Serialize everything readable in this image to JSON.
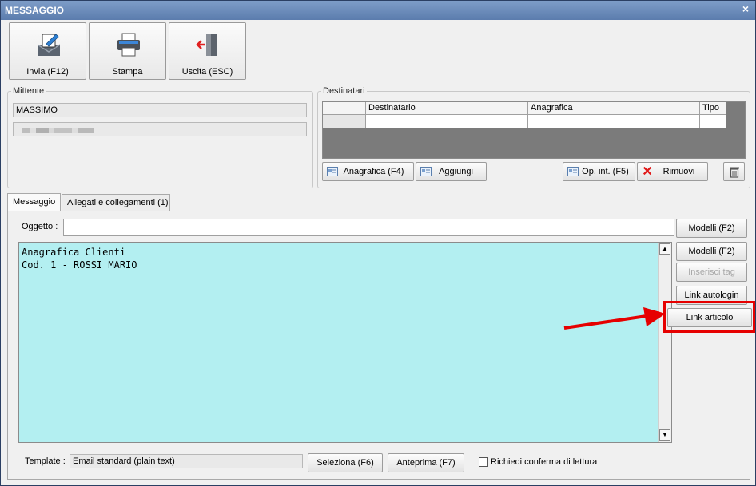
{
  "window": {
    "title": "MESSAGGIO",
    "close_glyph": "×"
  },
  "toolbar": {
    "send": {
      "label": "Invia (F12)",
      "icon": "send-mail-icon"
    },
    "print": {
      "label": "Stampa",
      "icon": "printer-icon"
    },
    "exit": {
      "label": "Uscita (ESC)",
      "icon": "exit-door-icon"
    }
  },
  "sender": {
    "legend": "Mittente",
    "name": "MASSIMO"
  },
  "recipients": {
    "legend": "Destinatari",
    "columns": [
      "Destinatario",
      "Anagrafica",
      "Tipo"
    ],
    "buttons": {
      "anagrafica": "Anagrafica (F4)",
      "aggiungi": "Aggiungi",
      "op_int": "Op. int. (F5)",
      "rimuovi": "Rimuovi"
    }
  },
  "tabs": [
    {
      "label": "Messaggio",
      "active": true
    },
    {
      "label": "Allegati e collegamenti (1)",
      "active": false
    }
  ],
  "message": {
    "subject_label": "Oggetto :",
    "subject_value": "",
    "body_lines": [
      "Anagrafica Clienti",
      "Cod. 1 - ROSSI MARIO"
    ],
    "body_color": "#b3eff1"
  },
  "side_buttons": {
    "modelli_top": "Modelli (F2)",
    "modelli": "Modelli (F2)",
    "inserisci_tag": "Inserisci tag",
    "link_autologin": "Link autologin",
    "link_articolo": "Link articolo"
  },
  "footer": {
    "template_label": "Template :",
    "template_value": "Email standard (plain text)",
    "seleziona": "Seleziona (F6)",
    "anteprima": "Anteprima (F7)",
    "confirm_label": "Richiedi conferma di lettura",
    "confirm_checked": false
  },
  "accent": {
    "highlight": "#e60000",
    "titlebar": "#6a8bbb"
  }
}
